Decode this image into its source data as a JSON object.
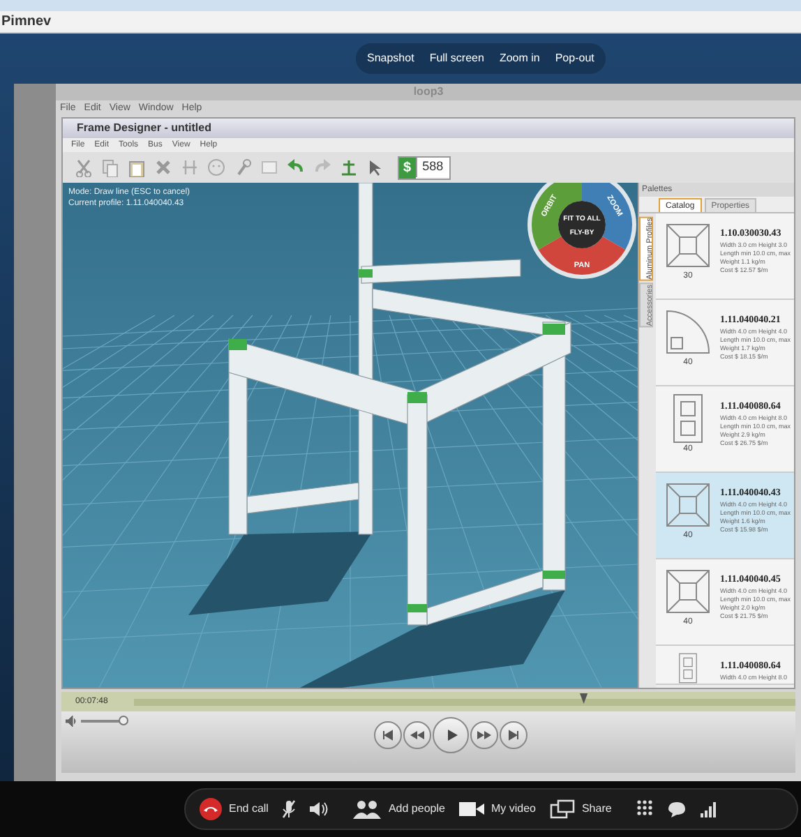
{
  "window": {
    "title": "Pimnev"
  },
  "video_toolbar": [
    "Snapshot",
    "Full screen",
    "Zoom in",
    "Pop-out"
  ],
  "shared_screen": {
    "title": "loop3",
    "menu": [
      "File",
      "Edit",
      "View",
      "Window",
      "Help"
    ],
    "app": {
      "title": "Frame Designer - untitled",
      "menu": [
        "File",
        "Edit",
        "Tools",
        "Bus",
        "View",
        "Help"
      ],
      "toolbar": {
        "price_symbol": "$",
        "price": "588"
      },
      "viewport": {
        "status_lines": [
          "Mode: Draw line (ESC to cancel)",
          "Current profile: 1.11.040040.43"
        ],
        "nav_wheel": {
          "segments": [
            {
              "label": "ORBIT",
              "color": "#5c9e3a"
            },
            {
              "label": "ZOOM",
              "color": "#3f7fb5"
            },
            {
              "label": "PAN",
              "color": "#d0463c"
            }
          ],
          "center": [
            "FIT TO ALL",
            "FLY-BY"
          ]
        }
      },
      "palette": {
        "title": "Palettes",
        "tabs": [
          {
            "label": "Catalog",
            "selected": true
          },
          {
            "label": "Properties",
            "selected": false
          }
        ],
        "side_tabs": [
          {
            "label": "Aluminum Profiles",
            "selected": true
          },
          {
            "label": "Accessories",
            "selected": false
          }
        ],
        "items": [
          {
            "code": "1.10.030030.43",
            "dimension": "30",
            "kind": "square",
            "selected": false,
            "details": [
              "Width 3.0 cm Height 3.0",
              "Length min 10.0 cm, max",
              "Weight 1.1 kg/m",
              "Cost $ 12.57 $/m"
            ]
          },
          {
            "code": "1.11.040040.21",
            "dimension": "40",
            "kind": "quarter",
            "selected": false,
            "details": [
              "Width 4.0 cm Height 4.0",
              "Length min 10.0 cm, max",
              "Weight 1.7 kg/m",
              "Cost $ 18.15 $/m"
            ]
          },
          {
            "code": "1.11.040080.64",
            "dimension": "40",
            "kind": "double",
            "selected": false,
            "details": [
              "Width 4.0 cm Height 8.0",
              "Length min 10.0 cm, max",
              "Weight 2.9 kg/m",
              "Cost $ 26.75 $/m"
            ]
          },
          {
            "code": "1.11.040040.43",
            "dimension": "40",
            "kind": "square",
            "selected": true,
            "details": [
              "Width 4.0 cm Height 4.0",
              "Length min 10.0 cm, max",
              "Weight 1.6 kg/m",
              "Cost $ 15.98 $/m"
            ]
          },
          {
            "code": "1.11.040040.45",
            "dimension": "40",
            "kind": "square",
            "selected": false,
            "details": [
              "Width 4.0 cm Height 4.0",
              "Length min 10.0 cm, max",
              "Weight 2.0 kg/m",
              "Cost $ 21.75 $/m"
            ]
          },
          {
            "code": "1.11.040080.64",
            "kind": "double",
            "selected": false,
            "details": [
              "Width 4.0 cm Height 8.0"
            ]
          }
        ]
      }
    },
    "player": {
      "time": "00:07:48",
      "seek": {
        "level": 0.68
      },
      "volume": {
        "level": 1.0
      },
      "buttons": [
        {
          "kind": "first"
        },
        {
          "kind": "rewind"
        },
        {
          "kind": "play"
        },
        {
          "kind": "forward"
        },
        {
          "kind": "last"
        }
      ]
    }
  },
  "call_bar": [
    {
      "kind": "end",
      "label": "End call"
    },
    {
      "kind": "mute"
    },
    {
      "kind": "speaker"
    },
    {
      "kind": "people",
      "label": "Add people"
    },
    {
      "kind": "video",
      "label": "My video"
    },
    {
      "kind": "share",
      "label": "Share"
    },
    {
      "kind": "dialpad"
    },
    {
      "kind": "chat"
    },
    {
      "kind": "signal"
    }
  ]
}
